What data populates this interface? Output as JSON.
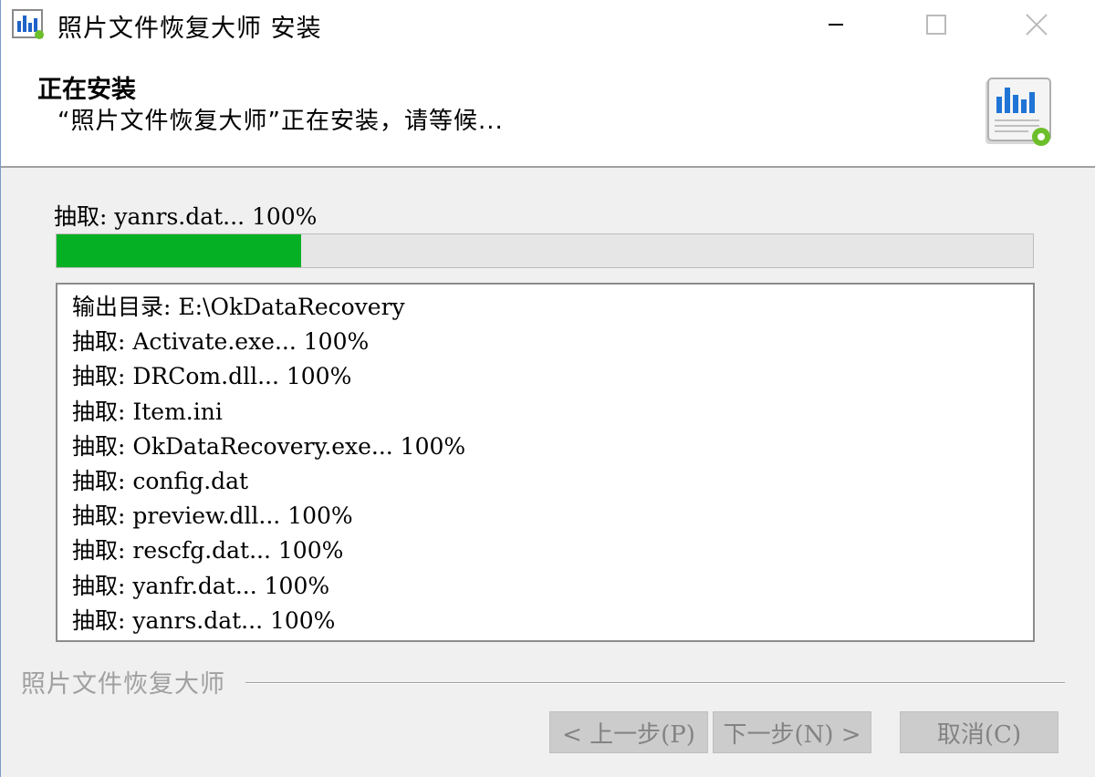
{
  "window": {
    "title": "照片文件恢复大师 安装",
    "icons": {
      "app": "bar-chart-icon",
      "minimize": "minimize-icon",
      "maximize": "maximize-icon",
      "close": "close-icon"
    }
  },
  "header": {
    "title": "正在安装",
    "subtitle": "“照片文件恢复大师”正在安装，请等候...",
    "logo_icon": "installer-chart-icon"
  },
  "status": {
    "text": "抽取: yanrs.dat... 100%",
    "progress_percent": 25
  },
  "log": {
    "lines": [
      "输出目录: E:\\OkDataRecovery",
      "抽取: Activate.exe... 100%",
      "抽取: DRCom.dll... 100%",
      "抽取: Item.ini",
      "抽取: OkDataRecovery.exe... 100%",
      "抽取: config.dat",
      "抽取: preview.dll... 100%",
      "抽取: rescfg.dat... 100%",
      "抽取: yanfr.dat... 100%",
      "抽取: yanrs.dat... 100%"
    ]
  },
  "footer": {
    "brand": "照片文件恢复大师",
    "back_label": "< 上一步(P)",
    "next_label": "下一步(N) >",
    "cancel_label": "取消(C)"
  },
  "colors": {
    "progress": "#06b025",
    "button_bg": "#cccccc",
    "disabled_text": "#838383"
  }
}
